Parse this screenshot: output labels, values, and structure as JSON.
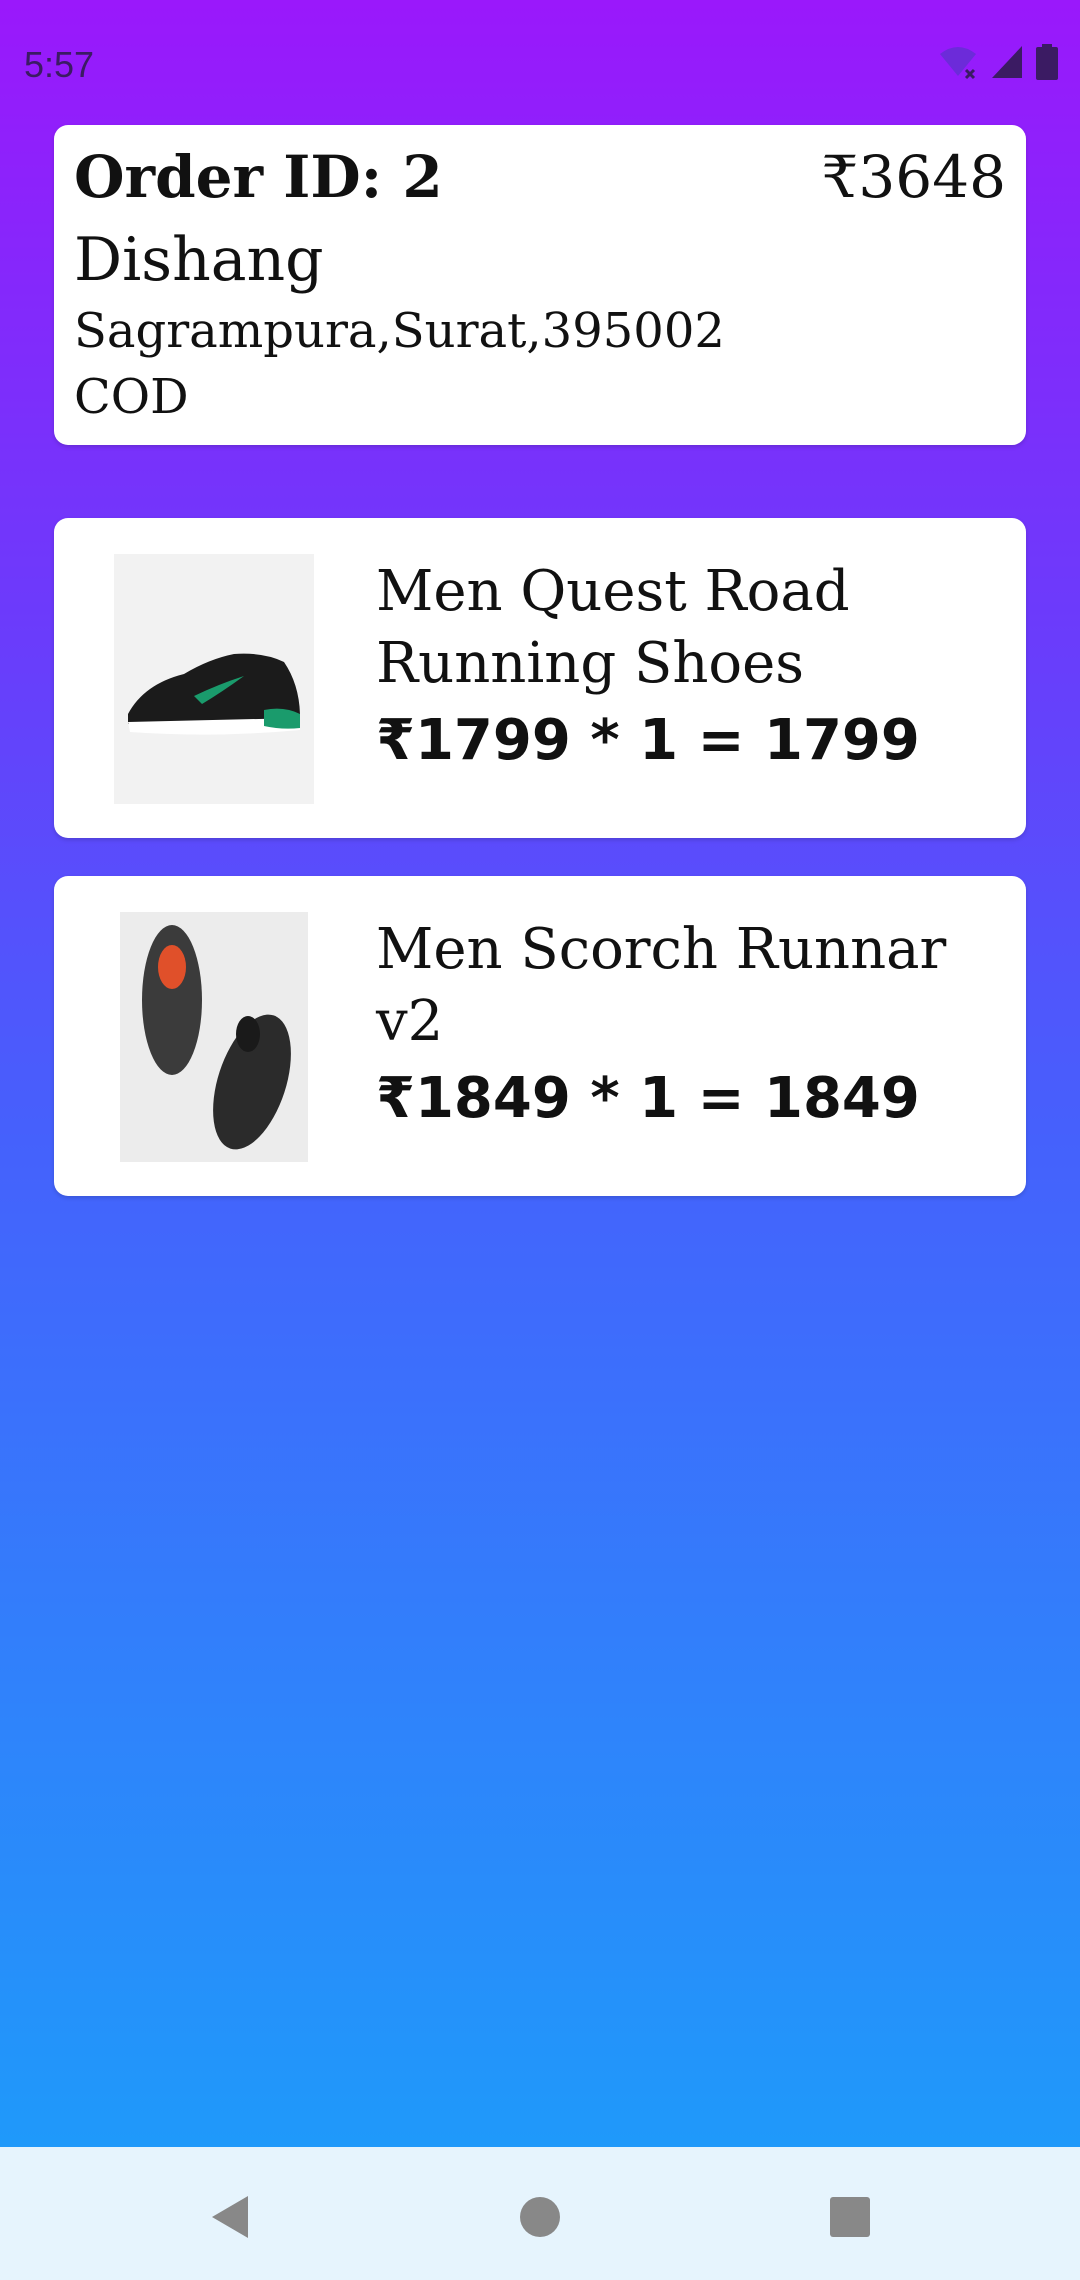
{
  "status_bar": {
    "time": "5:57",
    "icons": [
      "wifi-off-icon",
      "cellular-signal-icon",
      "battery-icon"
    ]
  },
  "order": {
    "id_label": "Order ID: 2",
    "total": "₹3648",
    "customer_name": "Dishang",
    "address": "Sagrampura,Surat,395002",
    "payment_method": "COD"
  },
  "items": [
    {
      "name": "Men Quest Road Running Shoes",
      "price_line": "₹1799 * 1 = 1799",
      "image": "black-running-shoe-image"
    },
    {
      "name": "Men Scorch Runnar v2",
      "price_line": "₹1849 * 1 = 1849",
      "image": "pair-of-grey-shoes-image"
    }
  ],
  "nav": {
    "icons": [
      "back-icon",
      "home-icon",
      "recent-apps-icon"
    ]
  },
  "colors": {
    "gradient_top": "#9a18fb",
    "gradient_bottom": "#1aa0f9",
    "nav_bar": "#e6f4fd"
  }
}
